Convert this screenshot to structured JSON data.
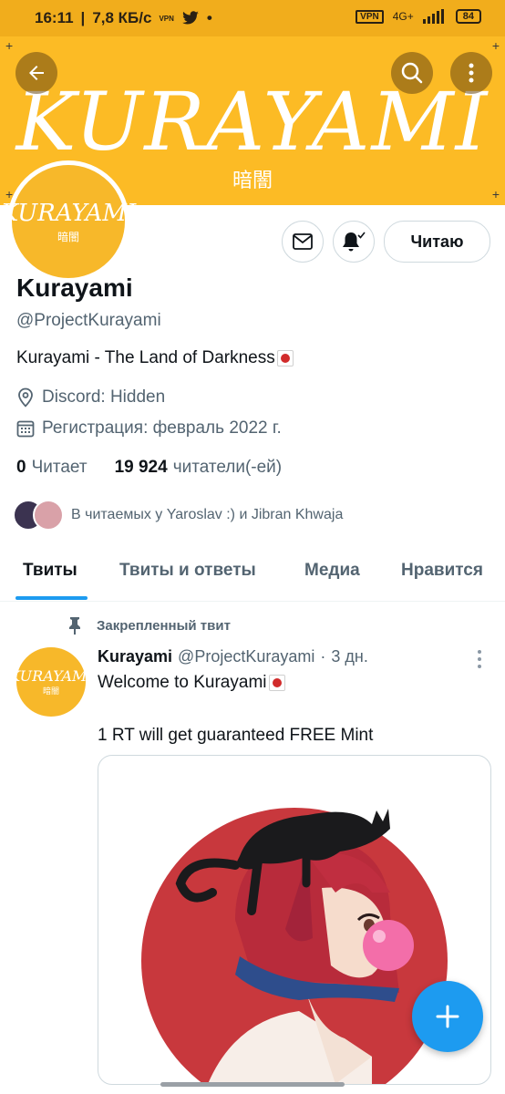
{
  "status_bar": {
    "time": "16:11",
    "separator": "|",
    "speed": "7,8 КБ/с",
    "vpn_small": "VPN",
    "dot": "•",
    "vpn_badge": "VPN",
    "network": "4G+",
    "battery": "84"
  },
  "banner": {
    "title": "KURAYAMI",
    "subtitle": "暗闇"
  },
  "avatar": {
    "logo_text": "KURAYAMI",
    "logo_sub": "暗闇"
  },
  "actions": {
    "follow_label": "Читаю"
  },
  "profile": {
    "name": "Kurayami",
    "handle": "@ProjectKurayami",
    "bio": "Kurayami - The Land of Darkness",
    "location": "Discord: Hidden",
    "joined": "Регистрация: февраль 2022 г."
  },
  "stats": {
    "following_count": "0",
    "following_label": "Читает",
    "followers_count": "19 924",
    "followers_label": "читатели(-ей)"
  },
  "followed_by": "В читаемых у Yaroslav :) и Jibran Khwaja",
  "tabs": [
    {
      "label": "Твиты"
    },
    {
      "label": "Твиты и ответы"
    },
    {
      "label": "Медиа"
    },
    {
      "label": "Нравится"
    }
  ],
  "pinned_label": "Закрепленный твит",
  "tweet": {
    "name": "Kurayami",
    "handle": "@ProjectKurayami",
    "dot": "·",
    "time": "3 дн.",
    "line1": "Welcome to Kurayami",
    "line2": "1 RT will get guaranteed FREE Mint"
  },
  "colors": {
    "banner": "#fcbb25",
    "accent": "#1d9bf0",
    "text_secondary": "#536471"
  }
}
